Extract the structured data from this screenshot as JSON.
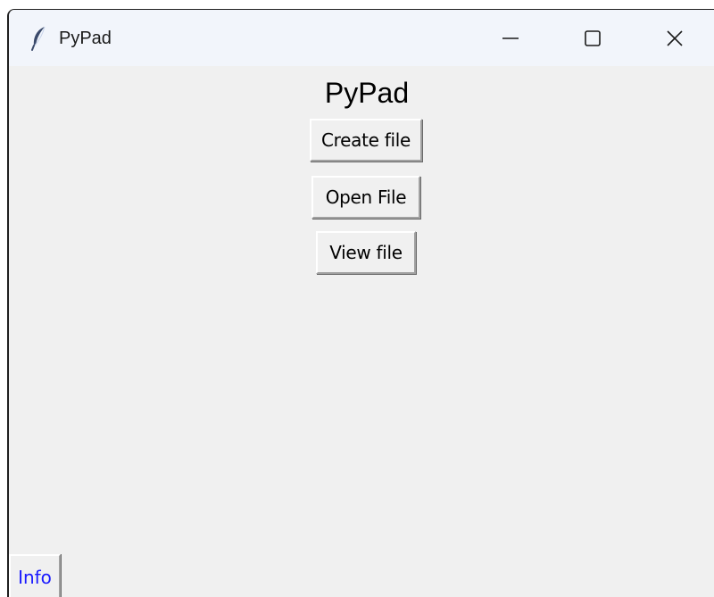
{
  "window": {
    "title": "PyPad",
    "icon": "feather-icon",
    "controls": {
      "minimize_icon": "minimize-icon",
      "maximize_icon": "maximize-icon",
      "close_icon": "close-icon"
    }
  },
  "main": {
    "heading": "PyPad",
    "buttons": {
      "create": "Create file",
      "open": "Open File",
      "view": "View file"
    }
  },
  "footer": {
    "info_label": "Info"
  },
  "colors": {
    "window_bg": "#f0f0f0",
    "titlebar_bg": "#f2f5fb",
    "info_text": "#1a1aff"
  }
}
